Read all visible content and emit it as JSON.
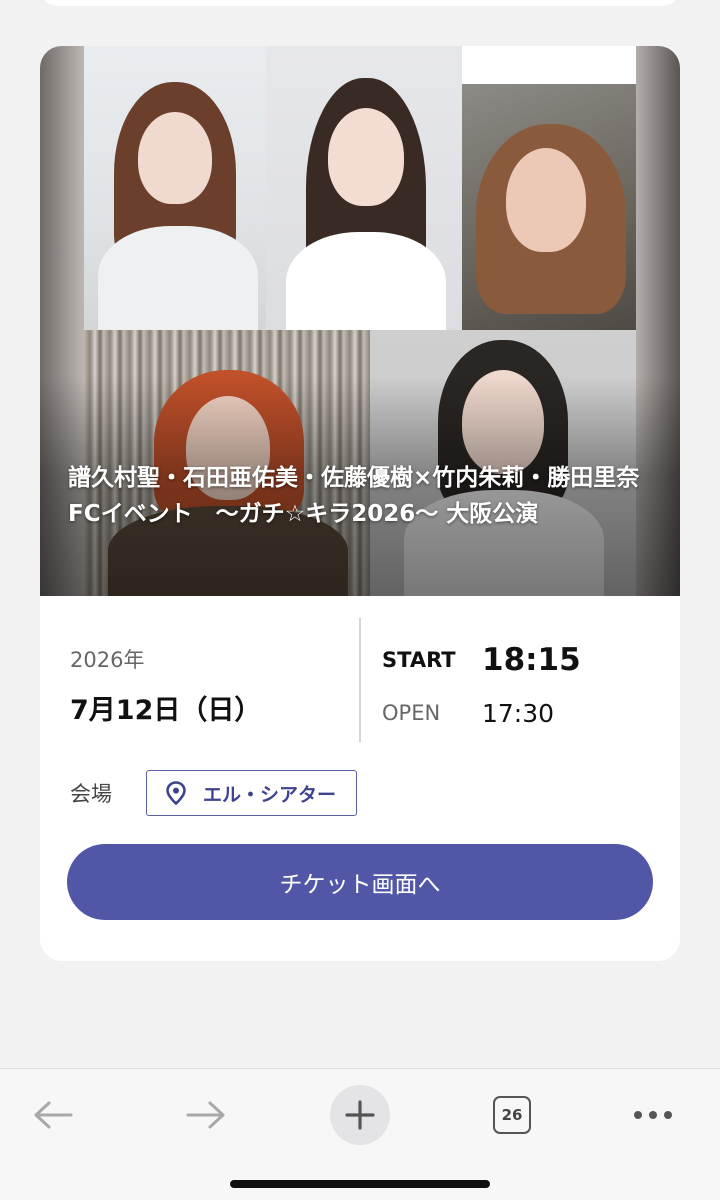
{
  "event": {
    "title": "譜久村聖・石田亜佑美・佐藤優樹×竹内朱莉・勝田里奈FCイベント　～ガチ☆キラ2026～ 大阪公演",
    "year": "2026年",
    "date": "7月12日（日）",
    "start_label": "START",
    "start_time": "18:15",
    "open_label": "OPEN",
    "open_time": "17:30",
    "venue_label": "会場",
    "venue_name": "エル・シアター",
    "venue_icon": "map-pin-icon",
    "ticket_button": "チケット画面へ",
    "accent_color": "#5157a6"
  },
  "toolbar": {
    "back_icon": "arrow-left-icon",
    "forward_icon": "arrow-right-icon",
    "new_tab_icon": "plus-icon",
    "tab_count": "26",
    "more_icon": "more-dots-icon"
  }
}
